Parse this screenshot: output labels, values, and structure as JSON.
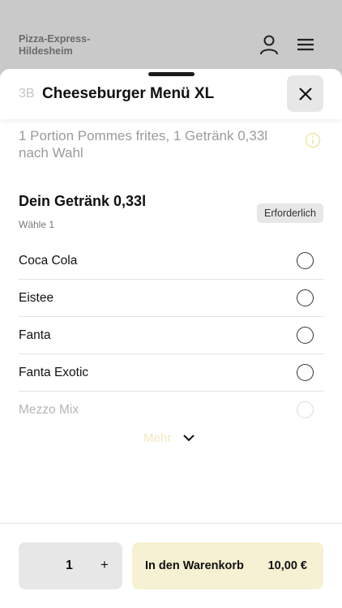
{
  "background": {
    "restaurant_name_line1": "Pizza-Express-",
    "restaurant_name_line2": "Hildesheim",
    "icons": [
      "user-icon",
      "menu-icon"
    ]
  },
  "item": {
    "number": "3B",
    "title": "Cheeseburger Menü XL",
    "description": "1 Portion Pommes frites, 1 Getränk 0,33l nach Wahl"
  },
  "section": {
    "title": "Dein Getränk 0,33l",
    "subtitle": "Wähle 1",
    "badge": "Erforderlich",
    "options": [
      {
        "label": "Coca Cola"
      },
      {
        "label": "Eistee"
      },
      {
        "label": "Fanta"
      },
      {
        "label": "Fanta Exotic"
      },
      {
        "label": "Mezzo Mix"
      }
    ],
    "more_label": "Mehr"
  },
  "footer": {
    "quantity": "1",
    "plus": "+",
    "cart_label": "In den Warenkorb",
    "price": "10,00 €"
  },
  "colors": {
    "accent": "#f6f1d3",
    "info_icon": "#f0e6a8"
  }
}
